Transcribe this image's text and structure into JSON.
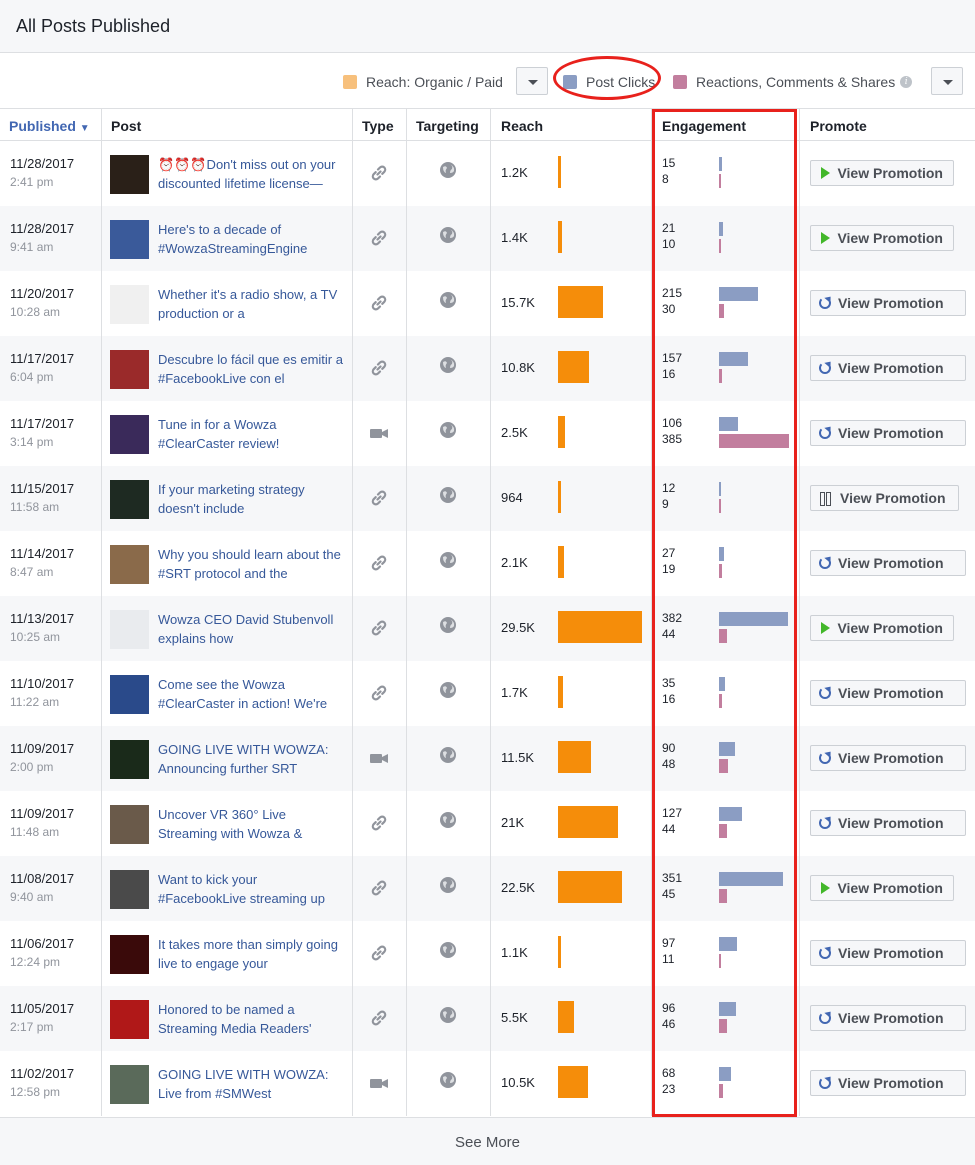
{
  "header": {
    "title": "All Posts Published"
  },
  "legend": {
    "reach": {
      "label": "Reach: Organic / Paid",
      "color": "#f7c07c"
    },
    "clicks": {
      "label": "Post Clicks",
      "color": "#8b9dc3"
    },
    "reactions": {
      "label": "Reactions, Comments & Shares",
      "color": "#c27e9e"
    },
    "info_icon": "i"
  },
  "columns": {
    "published": "Published",
    "post": "Post",
    "type": "Type",
    "targeting": "Targeting",
    "reach": "Reach",
    "engagement": "Engagement",
    "promote": "Promote"
  },
  "rows": [
    {
      "date": "11/28/2017",
      "time": "2:41 pm",
      "post": "⏰⏰⏰Don't miss out on your discounted lifetime license—",
      "type": "link",
      "reach": "1.2K",
      "reach_value": 1.2,
      "clicks": "15",
      "reactions": "8",
      "promote": "View Promotion",
      "status": "play",
      "thumb": "#2a2018"
    },
    {
      "date": "11/28/2017",
      "time": "9:41 am",
      "post": "Here's to a decade of #WowzaStreamingEngine",
      "type": "link",
      "reach": "1.4K",
      "reach_value": 1.4,
      "clicks": "21",
      "reactions": "10",
      "promote": "View Promotion",
      "status": "play",
      "thumb": "#3a5a9a"
    },
    {
      "date": "11/20/2017",
      "time": "10:28 am",
      "post": "Whether it's a radio show, a TV production or a",
      "type": "link",
      "reach": "15.7K",
      "reach_value": 15.7,
      "clicks": "215",
      "reactions": "30",
      "promote": "View Promotion",
      "status": "refresh",
      "thumb": "#f0f0f0"
    },
    {
      "date": "11/17/2017",
      "time": "6:04 pm",
      "post": "Descubre lo fácil que es emitir a #FacebookLive con el",
      "type": "link",
      "reach": "10.8K",
      "reach_value": 10.8,
      "clicks": "157",
      "reactions": "16",
      "promote": "View Promotion",
      "status": "refresh",
      "thumb": "#9a2a2a"
    },
    {
      "date": "11/17/2017",
      "time": "3:14 pm",
      "post": "Tune in for a Wowza #ClearCaster review!",
      "type": "video",
      "reach": "2.5K",
      "reach_value": 2.5,
      "clicks": "106",
      "reactions": "385",
      "promote": "View Promotion",
      "status": "refresh",
      "thumb": "#3a2a5a"
    },
    {
      "date": "11/15/2017",
      "time": "11:58 am",
      "post": "If your marketing strategy doesn't include",
      "type": "link",
      "reach": "964",
      "reach_value": 0.964,
      "clicks": "12",
      "reactions": "9",
      "promote": "View Promotion",
      "status": "pause",
      "thumb": "#1e2a22"
    },
    {
      "date": "11/14/2017",
      "time": "8:47 am",
      "post": "Why you should learn about the #SRT protocol and the",
      "type": "link",
      "reach": "2.1K",
      "reach_value": 2.1,
      "clicks": "27",
      "reactions": "19",
      "promote": "View Promotion",
      "status": "refresh",
      "thumb": "#8a6a4a"
    },
    {
      "date": "11/13/2017",
      "time": "10:25 am",
      "post": "Wowza CEO David Stubenvoll explains how",
      "type": "link",
      "reach": "29.5K",
      "reach_value": 29.5,
      "clicks": "382",
      "reactions": "44",
      "promote": "View Promotion",
      "status": "play",
      "thumb": "#e9ebee"
    },
    {
      "date": "11/10/2017",
      "time": "11:22 am",
      "post": "Come see the Wowza #ClearCaster in action! We're",
      "type": "link",
      "reach": "1.7K",
      "reach_value": 1.7,
      "clicks": "35",
      "reactions": "16",
      "promote": "View Promotion",
      "status": "refresh",
      "thumb": "#2a4a8a"
    },
    {
      "date": "11/09/2017",
      "time": "2:00 pm",
      "post": "GOING LIVE WITH WOWZA: Announcing further SRT",
      "type": "video",
      "reach": "11.5K",
      "reach_value": 11.5,
      "clicks": "90",
      "reactions": "48",
      "promote": "View Promotion",
      "status": "refresh",
      "thumb": "#1a2a1a"
    },
    {
      "date": "11/09/2017",
      "time": "11:48 am",
      "post": "Uncover VR 360° Live Streaming with Wowza &",
      "type": "link",
      "reach": "21K",
      "reach_value": 21,
      "clicks": "127",
      "reactions": "44",
      "promote": "View Promotion",
      "status": "refresh",
      "thumb": "#6a5a4a"
    },
    {
      "date": "11/08/2017",
      "time": "9:40 am",
      "post": "Want to kick your #FacebookLive streaming up",
      "type": "link",
      "reach": "22.5K",
      "reach_value": 22.5,
      "clicks": "351",
      "reactions": "45",
      "promote": "View Promotion",
      "status": "play",
      "thumb": "#4a4a4a"
    },
    {
      "date": "11/06/2017",
      "time": "12:24 pm",
      "post": "It takes more than simply going live to engage your",
      "type": "link",
      "reach": "1.1K",
      "reach_value": 1.1,
      "clicks": "97",
      "reactions": "11",
      "promote": "View Promotion",
      "status": "refresh",
      "thumb": "#3a0a0a"
    },
    {
      "date": "11/05/2017",
      "time": "2:17 pm",
      "post": "Honored to be named a Streaming Media Readers'",
      "type": "link",
      "reach": "5.5K",
      "reach_value": 5.5,
      "clicks": "96",
      "reactions": "46",
      "promote": "View Promotion",
      "status": "refresh",
      "thumb": "#b01818"
    },
    {
      "date": "11/02/2017",
      "time": "12:58 pm",
      "post": "GOING LIVE WITH WOWZA: Live from #SMWest",
      "type": "video",
      "reach": "10.5K",
      "reach_value": 10.5,
      "clicks": "68",
      "reactions": "23",
      "promote": "View Promotion",
      "status": "refresh",
      "thumb": "#5a6a5a"
    }
  ],
  "footer": {
    "see_more": "See More"
  }
}
